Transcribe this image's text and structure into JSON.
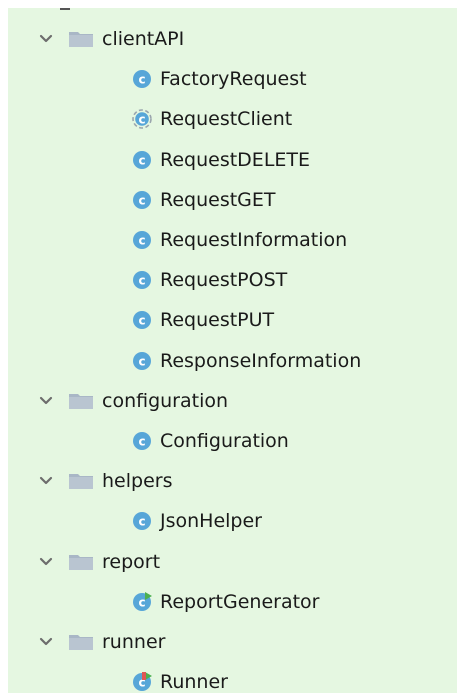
{
  "tree": {
    "packages": [
      {
        "name": "clientAPI",
        "classes": [
          {
            "name": "FactoryRequest",
            "kind": "class"
          },
          {
            "name": "RequestClient",
            "kind": "abstract-class"
          },
          {
            "name": "RequestDELETE",
            "kind": "class"
          },
          {
            "name": "RequestGET",
            "kind": "class"
          },
          {
            "name": "RequestInformation",
            "kind": "class"
          },
          {
            "name": "RequestPOST",
            "kind": "class"
          },
          {
            "name": "RequestPUT",
            "kind": "class"
          },
          {
            "name": "ResponseInformation",
            "kind": "class"
          }
        ]
      },
      {
        "name": "configuration",
        "classes": [
          {
            "name": "Configuration",
            "kind": "class"
          }
        ]
      },
      {
        "name": "helpers",
        "classes": [
          {
            "name": "JsonHelper",
            "kind": "class"
          }
        ]
      },
      {
        "name": "report",
        "classes": [
          {
            "name": "ReportGenerator",
            "kind": "runnable-class"
          }
        ]
      },
      {
        "name": "runner",
        "classes": [
          {
            "name": "Runner",
            "kind": "runnable-class-error"
          }
        ]
      }
    ]
  },
  "colors": {
    "background": "#e5f7e1",
    "class_icon": "#57a6d8",
    "folder_icon": "#a9b7c6",
    "run_marker": "#4caf50",
    "error_marker": "#e05555"
  },
  "icons": {
    "expand": "chevron-down-icon",
    "package": "folder-icon",
    "class": "class-icon",
    "abstract_class": "abstract-class-icon",
    "runnable_class": "runnable-class-icon"
  }
}
